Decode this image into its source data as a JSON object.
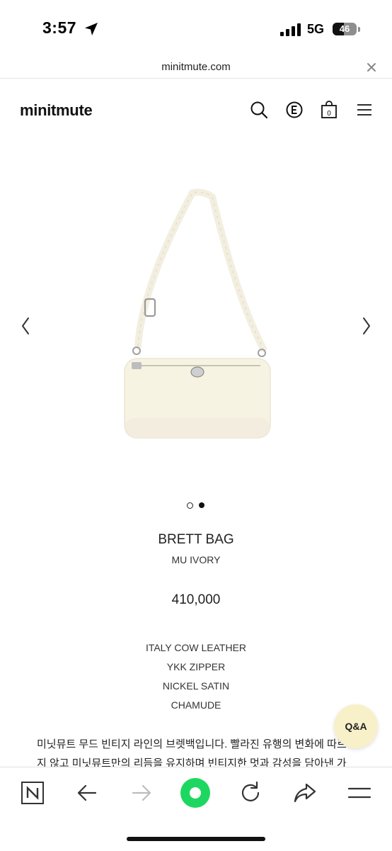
{
  "status_bar": {
    "time": "3:57",
    "network": "5G",
    "battery": "46",
    "battery_level": 0.46,
    "icons": [
      "location-arrow-icon",
      "signal-bars-icon",
      "battery-icon"
    ]
  },
  "browser": {
    "url": "minitmute.com",
    "close_icon": "close-icon"
  },
  "site": {
    "logo": "minitmute",
    "header_icons": [
      "search-icon",
      "currency-e-icon",
      "cart-icon",
      "menu-icon"
    ],
    "cart_count": "0"
  },
  "product": {
    "name": "BRETT BAG",
    "color": "MU IVORY",
    "price": "410,000",
    "specs": [
      "ITALY COW LEATHER",
      "YKK ZIPPER",
      "NICKEL SATIN",
      "CHAMUDE"
    ],
    "description_lines": [
      "미닛뮤트 무드 빈티지 라인의 브렛백입니다. 빨라진 유행의 변화에 따르",
      "지 않고 미닛뮤트만의 리듬을 유지하며 빈티지한 멋과 감성을 담아낸 가"
    ],
    "image_count": 2,
    "image_index": 2
  },
  "qa_button": {
    "label": "Q&A",
    "color": "#f8f0c9"
  },
  "toolbar": {
    "icons": [
      "naver-n-icon",
      "back-arrow-icon",
      "forward-arrow-icon",
      "green-home-icon",
      "reload-icon",
      "share-icon",
      "menu-icon"
    ],
    "accent": "#1ed760"
  }
}
